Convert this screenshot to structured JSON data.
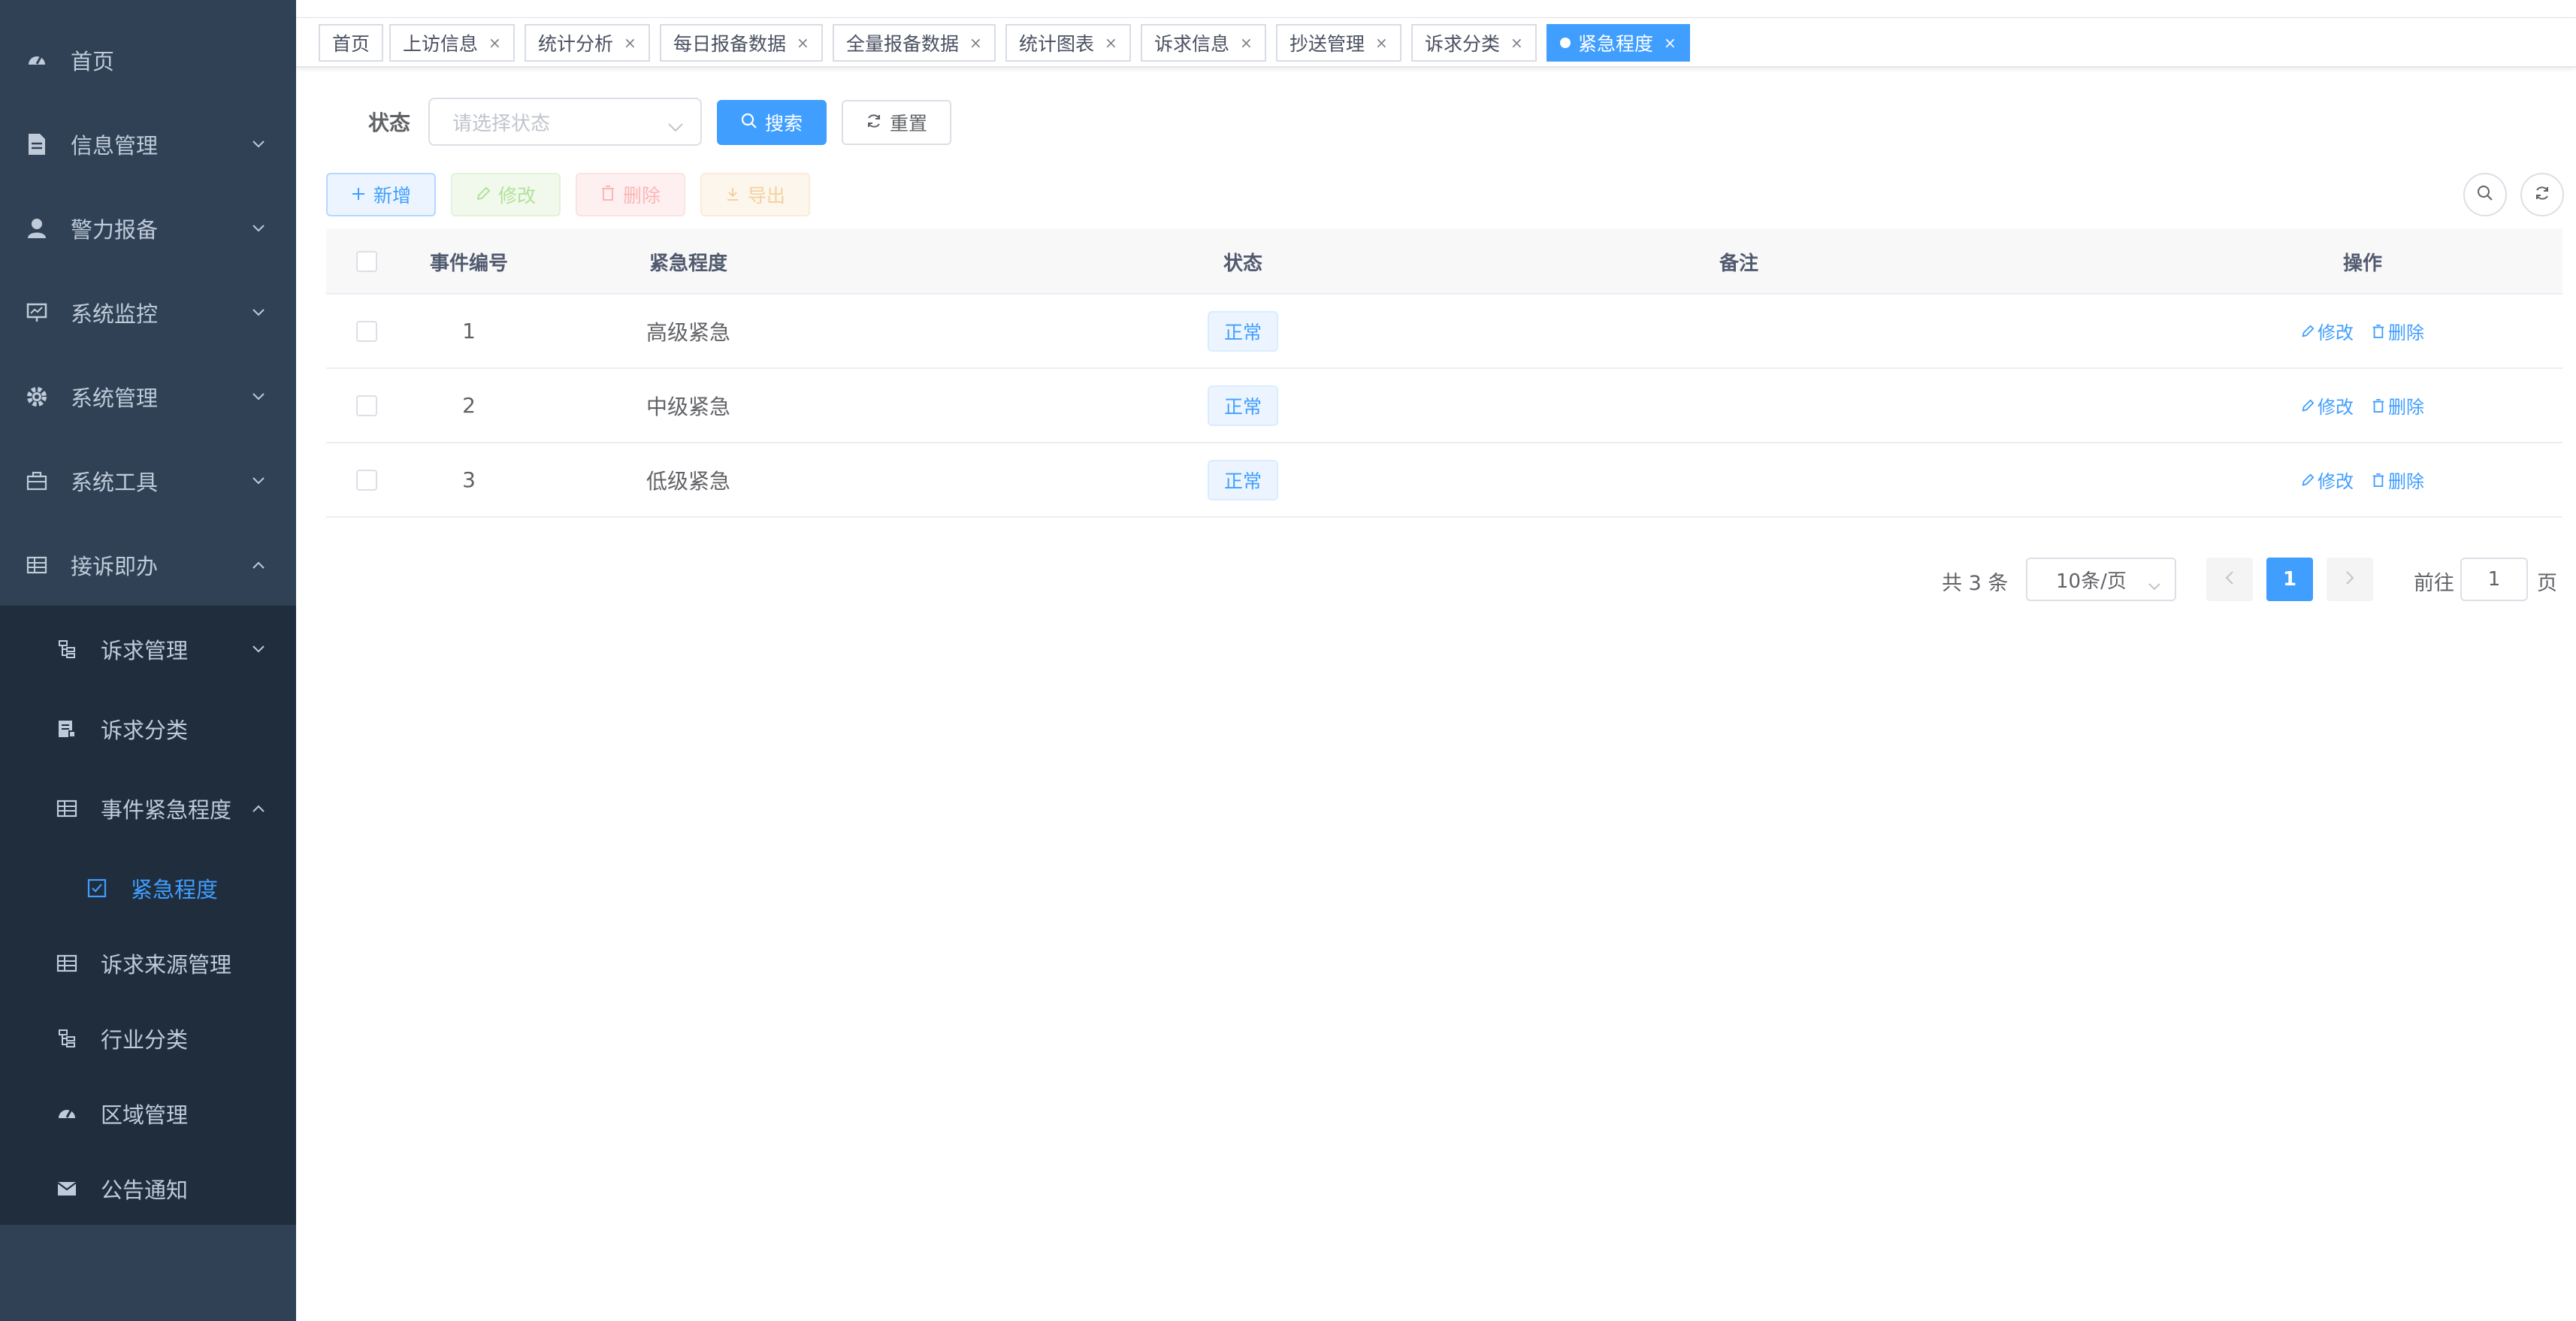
{
  "sidebar": {
    "items": [
      {
        "label": "首页",
        "icon": "dashboard-icon"
      },
      {
        "label": "信息管理",
        "icon": "document-icon"
      },
      {
        "label": "警力报备",
        "icon": "user-icon"
      },
      {
        "label": "系统监控",
        "icon": "monitor-icon"
      },
      {
        "label": "系统管理",
        "icon": "gear-icon"
      },
      {
        "label": "系统工具",
        "icon": "toolbox-icon"
      },
      {
        "label": "接诉即办",
        "icon": "table-icon"
      },
      {
        "label": "诉求管理",
        "icon": "tree-icon"
      },
      {
        "label": "诉求分类",
        "icon": "list-icon"
      },
      {
        "label": "事件紧急程度",
        "icon": "table-icon"
      },
      {
        "label": "紧急程度",
        "icon": "checkbox-icon"
      },
      {
        "label": "诉求来源管理",
        "icon": "table-icon"
      },
      {
        "label": "行业分类",
        "icon": "tree-icon"
      },
      {
        "label": "区域管理",
        "icon": "dashboard-icon"
      },
      {
        "label": "公告通知",
        "icon": "message-icon"
      }
    ],
    "active_color": "#409eff",
    "bg_color": "#304156"
  },
  "tags": [
    {
      "label": "首页"
    },
    {
      "label": "上访信息"
    },
    {
      "label": "统计分析"
    },
    {
      "label": "每日报备数据"
    },
    {
      "label": "全量报备数据"
    },
    {
      "label": "统计图表"
    },
    {
      "label": "诉求信息"
    },
    {
      "label": "抄送管理"
    },
    {
      "label": "诉求分类"
    },
    {
      "label": "紧急程度"
    }
  ],
  "tag_close": "×",
  "search": {
    "status_label": "状态",
    "status_placeholder": "请选择状态",
    "search_button": "搜索",
    "reset_button": "重置"
  },
  "toolbar": {
    "add": "新增",
    "edit": "修改",
    "delete": "删除",
    "export": "导出"
  },
  "table": {
    "headers": [
      "事件编号",
      "紧急程度",
      "状态",
      "备注",
      "操作"
    ],
    "rows": [
      {
        "id": "1",
        "level": "高级紧急",
        "status": "正常",
        "remark": ""
      },
      {
        "id": "2",
        "level": "中级紧急",
        "status": "正常",
        "remark": ""
      },
      {
        "id": "3",
        "level": "低级紧急",
        "status": "正常",
        "remark": ""
      }
    ],
    "op_edit": "修改",
    "op_delete": "删除"
  },
  "pagination": {
    "total": "共 3 条",
    "page_size": "10条/页",
    "current_page": "1",
    "goto_label": "前往",
    "goto_value": "1",
    "page_suffix": "页"
  }
}
